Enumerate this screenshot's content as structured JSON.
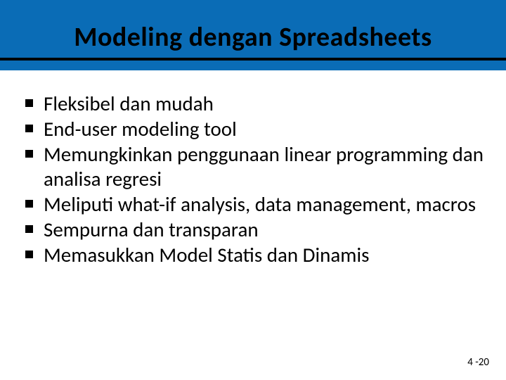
{
  "title": "Modeling dengan Spreadsheets",
  "bullets": {
    "b0": "Fleksibel dan mudah",
    "b1": "End-user modeling tool",
    "b2": "Memungkinkan penggunaan linear programming dan analisa regresi",
    "b3": "Meliputi what-if analysis, data management, macros",
    "b4": "Sempurna  dan transparan",
    "b5": "Memasukkan Model Statis dan Dinamis"
  },
  "footer": "4 -20"
}
